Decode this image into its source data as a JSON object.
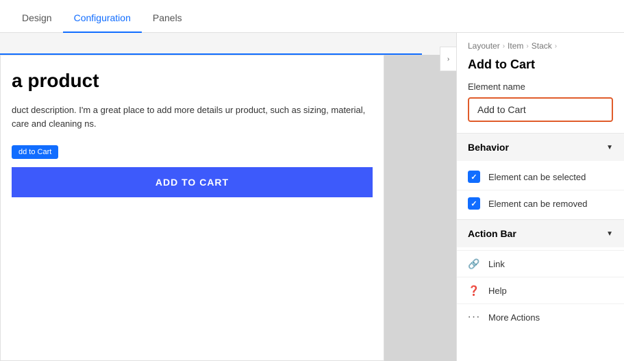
{
  "nav": {
    "tabs": [
      {
        "id": "design",
        "label": "Design",
        "active": false
      },
      {
        "id": "configuration",
        "label": "Configuration",
        "active": true
      },
      {
        "id": "panels",
        "label": "Panels",
        "active": false
      }
    ]
  },
  "preview": {
    "product_title": "a product",
    "product_description": "duct description. I'm a great place to add more details ur product, such as sizing, material, care and cleaning ns.",
    "add_to_cart_badge": "dd to Cart",
    "add_to_cart_button": "ADD TO CART"
  },
  "collapse_icon": "›",
  "right_panel": {
    "breadcrumb": {
      "items": [
        "Layouter",
        "Item",
        "Stack"
      ]
    },
    "breadcrumb_separators": [
      "›",
      "›",
      "›"
    ],
    "title": "Add to Cart",
    "element_name_label": "Element name",
    "element_name_value": "Add to Cart",
    "behavior_section": {
      "title": "Behavior",
      "chevron": "▼",
      "items": [
        {
          "label": "Element can be selected",
          "checked": true
        },
        {
          "label": "Element can be removed",
          "checked": true
        }
      ]
    },
    "action_bar_section": {
      "title": "Action Bar",
      "chevron": "▼",
      "items": [
        {
          "label": "Link",
          "icon": "🔗"
        },
        {
          "label": "Help",
          "icon": "❓"
        },
        {
          "label": "More Actions",
          "icon": "···"
        }
      ]
    }
  }
}
